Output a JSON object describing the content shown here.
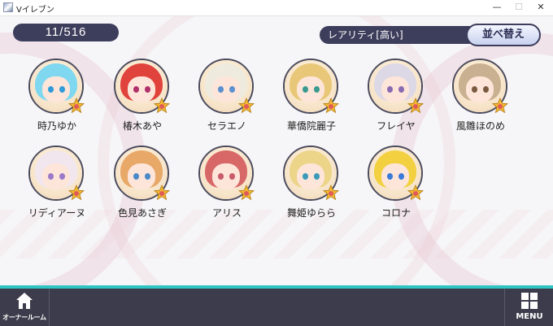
{
  "window": {
    "title": "Vイレブン",
    "controls": {
      "minimize": "—",
      "maximize": "☐",
      "close": "✕"
    }
  },
  "counter": "11/516",
  "sort": {
    "label": "レアリティ[高い]",
    "button": "並べ替え"
  },
  "characters": [
    {
      "name": "時乃ゆか",
      "hair": "#7fd8f0",
      "eye": "#2f9bd8"
    },
    {
      "name": "椿木あや",
      "hair": "#e0423c",
      "eye": "#b0306a"
    },
    {
      "name": "セラエノ",
      "hair": "#eeeade",
      "eye": "#5a8fd0"
    },
    {
      "name": "華僑院麗子",
      "hair": "#e8c878",
      "eye": "#3a9a90"
    },
    {
      "name": "フレイヤ",
      "hair": "#dcd8e6",
      "eye": "#8a6ab0"
    },
    {
      "name": "風雛ほのめ",
      "hair": "#c8b090",
      "eye": "#7a5a40"
    },
    {
      "name": "リディアーヌ",
      "hair": "#f2e6ee",
      "eye": "#9a7ac8"
    },
    {
      "name": "色見あさぎ",
      "hair": "#e8a868",
      "eye": "#4a8ac8"
    },
    {
      "name": "アリス",
      "hair": "#d86868",
      "eye": "#c85a6a"
    },
    {
      "name": "舞姫ゆらら",
      "hair": "#ecd488",
      "eye": "#3a9ab8"
    },
    {
      "name": "コロナ",
      "hair": "#f2d040",
      "eye": "#3a7ad8"
    }
  ],
  "icons": {
    "rarity_star": "star-icon",
    "home": "home-icon",
    "menu": "grid-icon"
  },
  "colors": {
    "accent": "#2ec4c4",
    "panel": "#3d3d5c",
    "bottom_bar": "#3c3c4c",
    "star": "#f4b832"
  },
  "bottom": {
    "owner_room": "オーナールーム",
    "menu": "MENU"
  }
}
